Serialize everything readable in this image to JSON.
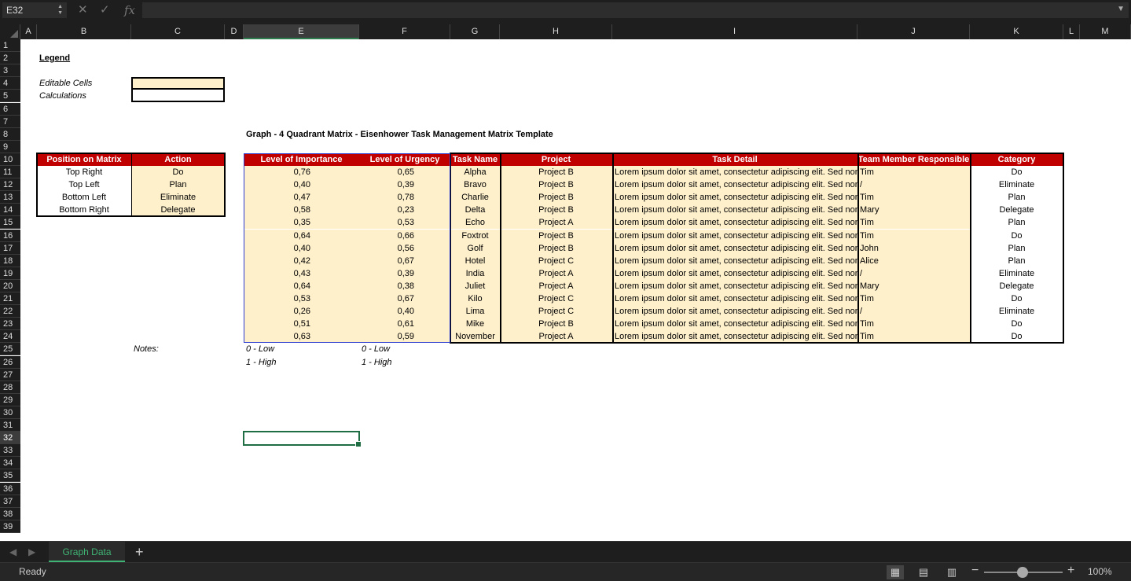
{
  "formula_bar": {
    "name_box": "E32",
    "fx": "fx",
    "formula": ""
  },
  "columns": [
    "A",
    "B",
    "C",
    "D",
    "E",
    "F",
    "G",
    "H",
    "I",
    "J",
    "K",
    "L",
    "M"
  ],
  "rows": [
    "1",
    "2",
    "3",
    "4",
    "5",
    "6",
    "7",
    "8",
    "9",
    "10",
    "11",
    "12",
    "13",
    "14",
    "15",
    "16",
    "17",
    "18",
    "19",
    "20",
    "21",
    "22",
    "23",
    "24",
    "25",
    "26",
    "27",
    "28",
    "29",
    "30",
    "31",
    "32",
    "33",
    "34",
    "35",
    "36",
    "37",
    "38",
    "39"
  ],
  "legend": {
    "title": "Legend",
    "editable_label": "Editable Cells",
    "calculations_label": "Calculations"
  },
  "graph_title": "Graph - 4 Quadrant Matrix  - Eisenhower Task Management Matrix Template",
  "matrix_table": {
    "headers": [
      "Position on Matrix",
      "Action"
    ],
    "rows": [
      [
        "Top Right",
        "Do"
      ],
      [
        "Top Left",
        "Plan"
      ],
      [
        "Bottom Left",
        "Eliminate"
      ],
      [
        "Bottom Right",
        "Delegate"
      ]
    ]
  },
  "task_table": {
    "headers": [
      "Level of Importance",
      "Level of Urgency",
      "Task Name",
      "Project",
      "Task Detail",
      "Team Member Responsible",
      "Category"
    ],
    "rows": [
      [
        "0,76",
        "0,65",
        "Alpha",
        "Project B",
        "Lorem ipsum dolor sit amet, consectetur adipiscing elit. Sed non",
        "Tim",
        "Do"
      ],
      [
        "0,40",
        "0,39",
        "Bravo",
        "Project B",
        "Lorem ipsum dolor sit amet, consectetur adipiscing elit. Sed non",
        "/",
        "Eliminate"
      ],
      [
        "0,47",
        "0,78",
        "Charlie",
        "Project B",
        "Lorem ipsum dolor sit amet, consectetur adipiscing elit. Sed non",
        "Tim",
        "Plan"
      ],
      [
        "0,58",
        "0,23",
        "Delta",
        "Project B",
        "Lorem ipsum dolor sit amet, consectetur adipiscing elit. Sed non",
        "Mary",
        "Delegate"
      ],
      [
        "0,35",
        "0,53",
        "Echo",
        "Project A",
        "Lorem ipsum dolor sit amet, consectetur adipiscing elit. Sed non",
        "Tim",
        "Plan"
      ],
      [
        "0,64",
        "0,66",
        "Foxtrot",
        "Project B",
        "Lorem ipsum dolor sit amet, consectetur adipiscing elit. Sed non",
        "Tim",
        "Do"
      ],
      [
        "0,40",
        "0,56",
        "Golf",
        "Project B",
        "Lorem ipsum dolor sit amet, consectetur adipiscing elit. Sed non",
        "John",
        "Plan"
      ],
      [
        "0,42",
        "0,67",
        "Hotel",
        "Project C",
        "Lorem ipsum dolor sit amet, consectetur adipiscing elit. Sed non",
        "Alice",
        "Plan"
      ],
      [
        "0,43",
        "0,39",
        "India",
        "Project A",
        "Lorem ipsum dolor sit amet, consectetur adipiscing elit. Sed non",
        "/",
        "Eliminate"
      ],
      [
        "0,64",
        "0,38",
        "Juliet",
        "Project A",
        "Lorem ipsum dolor sit amet, consectetur adipiscing elit. Sed non",
        "Mary",
        "Delegate"
      ],
      [
        "0,53",
        "0,67",
        "Kilo",
        "Project C",
        "Lorem ipsum dolor sit amet, consectetur adipiscing elit. Sed non",
        "Tim",
        "Do"
      ],
      [
        "0,26",
        "0,40",
        "Lima",
        "Project C",
        "Lorem ipsum dolor sit amet, consectetur adipiscing elit. Sed non",
        "/",
        "Eliminate"
      ],
      [
        "0,51",
        "0,61",
        "Mike",
        "Project B",
        "Lorem ipsum dolor sit amet, consectetur adipiscing elit. Sed non",
        "Tim",
        "Do"
      ],
      [
        "0,63",
        "0,59",
        "November",
        "Project A",
        "Lorem ipsum dolor sit amet, consectetur adipiscing elit. Sed non",
        "Tim",
        "Do"
      ]
    ]
  },
  "notes": {
    "label": "Notes:",
    "imp_low": "0 - Low",
    "imp_high": "1 - High",
    "urg_low": "0 - Low",
    "urg_high": "1 - High"
  },
  "sheet_tabs": [
    {
      "label": "Graph Data",
      "active": true
    }
  ],
  "add_sheet": "+",
  "status": {
    "text": "Ready",
    "zoom": "100%"
  },
  "colors": {
    "header_red": "#c00000",
    "editable_fill": "#fff0cc",
    "selection_green": "#1f6e43"
  }
}
